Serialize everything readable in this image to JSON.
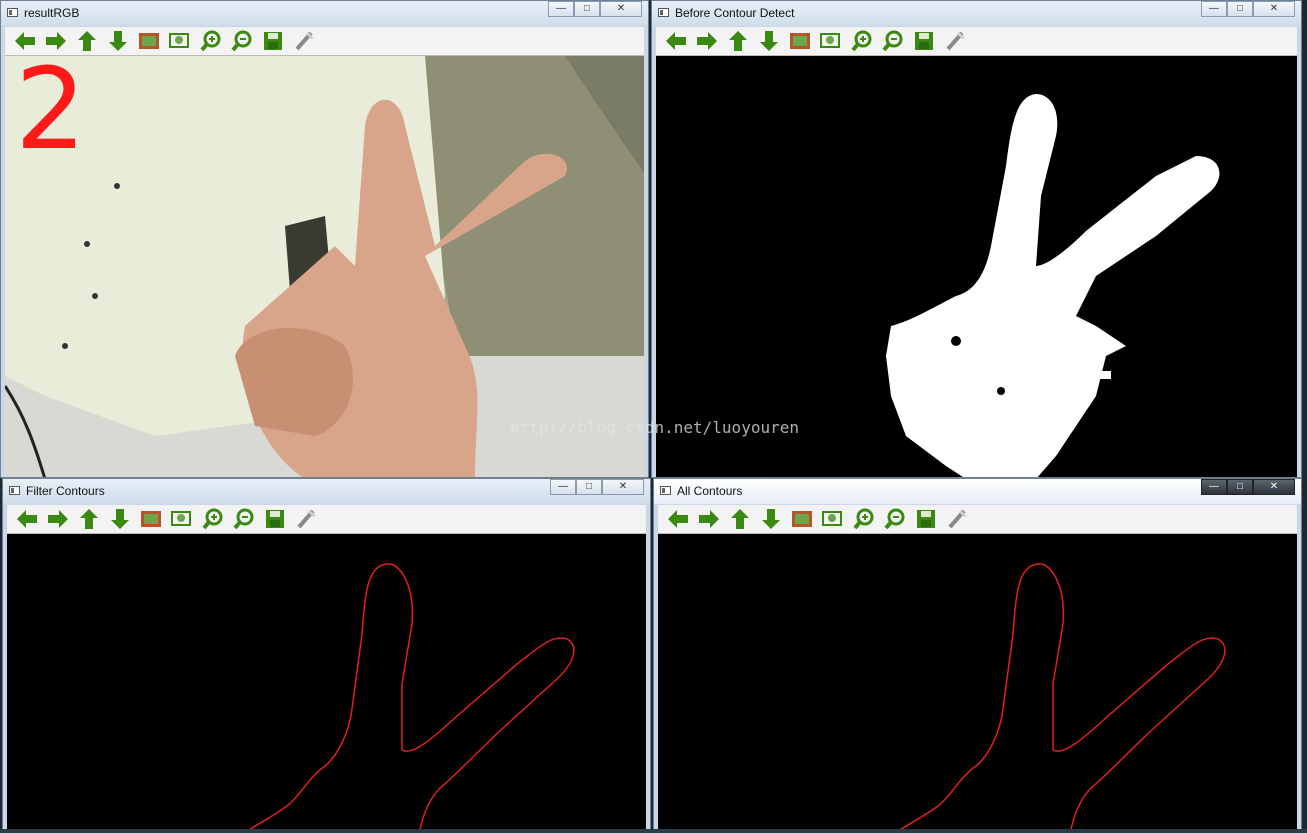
{
  "windows": {
    "result_rgb": {
      "title": "resultRGB",
      "overlay_digit": "2"
    },
    "before_contour": {
      "title": "Before Contour Detect"
    },
    "filter_contours": {
      "title": "Filter Contours"
    },
    "all_contours": {
      "title": "All Contours"
    }
  },
  "toolbar_buttons": [
    "pan-left",
    "pan-right",
    "pan-up",
    "pan-down",
    "zoom-fit-image",
    "zoom-region",
    "zoom-in",
    "zoom-out",
    "save",
    "properties"
  ],
  "window_controls": {
    "minimize": "—",
    "maximize": "□",
    "close": "✕"
  },
  "watermark": "http://blog.csdn.net/luoyouren",
  "colors": {
    "contour": "#e02020",
    "mask": "#ffffff",
    "digit": "#ff1a1a",
    "toolbar_arrow": "#3a8a12"
  }
}
